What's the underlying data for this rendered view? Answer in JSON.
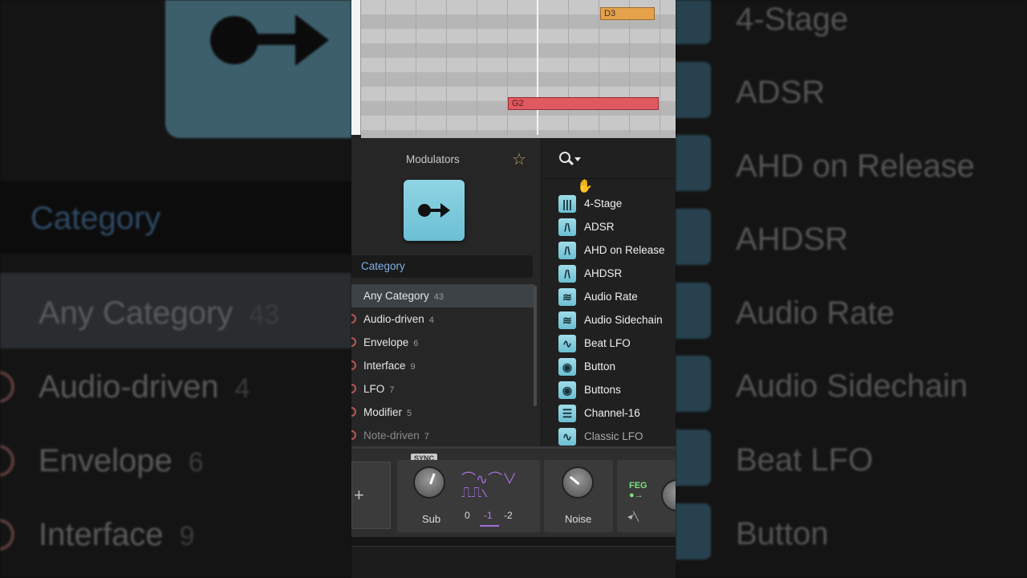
{
  "piano_roll": {
    "notes": [
      {
        "label": "D3",
        "color": "#e5a24b"
      },
      {
        "label": "G2",
        "color": "#e05860"
      }
    ]
  },
  "browser": {
    "title": "Modulators",
    "category_header": "Category",
    "categories": [
      {
        "label": "Any Category",
        "count": "43"
      },
      {
        "label": "Audio-driven",
        "count": "4"
      },
      {
        "label": "Envelope",
        "count": "6"
      },
      {
        "label": "Interface",
        "count": "9"
      },
      {
        "label": "LFO",
        "count": "7"
      },
      {
        "label": "Modifier",
        "count": "5"
      },
      {
        "label": "Note-driven",
        "count": "7"
      }
    ],
    "devices": [
      {
        "label": "4-Stage",
        "icon": "bars-icon"
      },
      {
        "label": "ADSR",
        "icon": "envelope-icon"
      },
      {
        "label": "AHD on Release",
        "icon": "envelope-icon"
      },
      {
        "label": "AHDSR",
        "icon": "envelope-icon"
      },
      {
        "label": "Audio Rate",
        "icon": "audio-wave-icon"
      },
      {
        "label": "Audio Sidechain",
        "icon": "audio-wave-icon"
      },
      {
        "label": "Beat LFO",
        "icon": "sine-icon"
      },
      {
        "label": "Button",
        "icon": "button-icon"
      },
      {
        "label": "Buttons",
        "icon": "button-icon"
      },
      {
        "label": "Channel-16",
        "icon": "channel-icon"
      },
      {
        "label": "Classic LFO",
        "icon": "sine-icon"
      }
    ]
  },
  "device_chain": {
    "sync_label": "SYNC",
    "sub_label": "Sub",
    "noise_label": "Noise",
    "octaves": [
      "0",
      "-1",
      "-2"
    ],
    "active_octave": "-1",
    "feg_label": "FEG"
  },
  "backdrop": {
    "left_categories": [
      {
        "label": "Any Category",
        "count": "43"
      },
      {
        "label": "Audio-driven",
        "count": "4"
      },
      {
        "label": "Envelope",
        "count": "6"
      },
      {
        "label": "Interface",
        "count": "9"
      }
    ],
    "left_header": "Category",
    "right_devices": [
      "4-Stage",
      "ADSR",
      "AHD on Release",
      "AHDSR",
      "Audio Rate",
      "Audio Sidechain",
      "Beat LFO",
      "Button"
    ]
  }
}
